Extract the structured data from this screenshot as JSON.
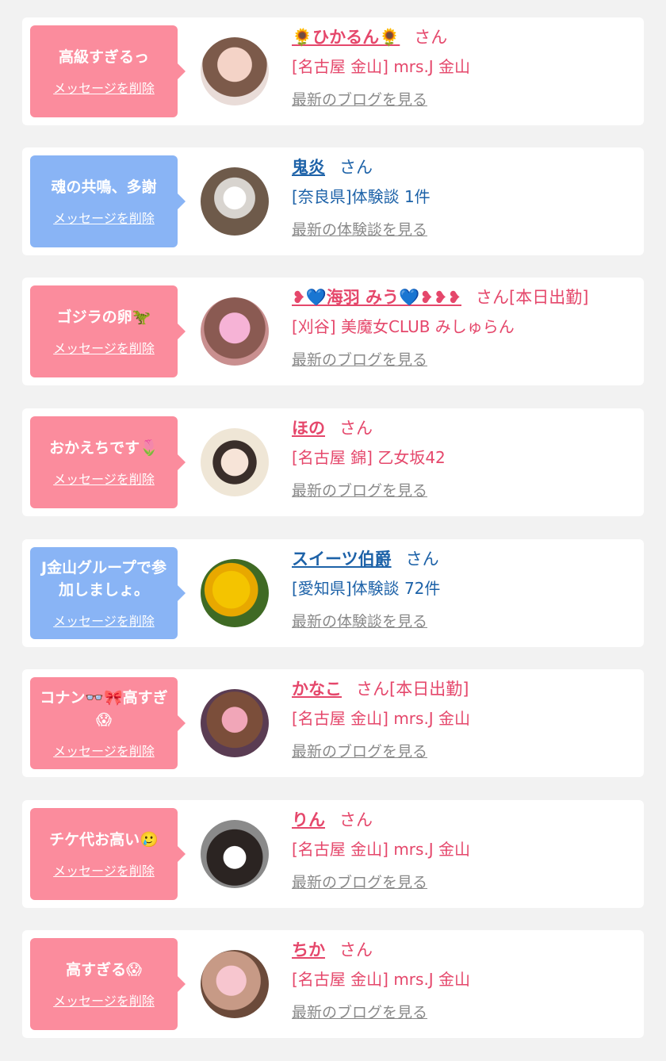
{
  "delete_label": "メッセージを削除",
  "items": [
    {
      "message": "高級すぎるっ",
      "type": "pink",
      "name": "🌻ひかるん🌻",
      "suffix": "さん",
      "shop": "[名古屋 金山] mrs.J 金山",
      "link": "最新のブログを見る"
    },
    {
      "message": "魂の共鳴、多謝",
      "type": "blue",
      "name": "鬼炎",
      "suffix": "さん",
      "shop": "[奈良県]体験談 1件",
      "link": "最新の体験談を見る"
    },
    {
      "message": "ゴジラの卵🦖",
      "type": "pink",
      "name": "❥💙海羽 みう💙❥❥❥",
      "suffix": "さん[本日出勤]",
      "shop": "[刈谷] 美魔女CLUB みしゅらん",
      "link": "最新のブログを見る"
    },
    {
      "message": "おかえちです🌷",
      "type": "pink",
      "name": "ほの",
      "suffix": "さん",
      "shop": "[名古屋 錦] 乙女坂42",
      "link": "最新のブログを見る"
    },
    {
      "message": "J金山グループで参加しましょ。",
      "type": "blue",
      "name": "スイーツ伯爵",
      "suffix": "さん",
      "shop": "[愛知県]体験談 72件",
      "link": "最新の体験談を見る"
    },
    {
      "message": "コナン👓🎀高すぎ😱",
      "type": "pink",
      "name": "かなこ",
      "suffix": "さん[本日出勤]",
      "shop": "[名古屋 金山] mrs.J 金山",
      "link": "最新のブログを見る"
    },
    {
      "message": "チケ代お高い🥲",
      "type": "pink",
      "name": "りん",
      "suffix": "さん",
      "shop": "[名古屋 金山] mrs.J 金山",
      "link": "最新のブログを見る"
    },
    {
      "message": "高すぎる😱",
      "type": "pink",
      "name": "ちか",
      "suffix": "さん",
      "shop": "[名古屋 金山] mrs.J 金山",
      "link": "最新のブログを見る"
    }
  ],
  "colors": {
    "pink_bubble": "#fb8c9d",
    "blue_bubble": "#89b4f5",
    "pink_text": "#e5476b",
    "blue_text": "#1d62a8",
    "link_gray": "#8a8a8a"
  }
}
